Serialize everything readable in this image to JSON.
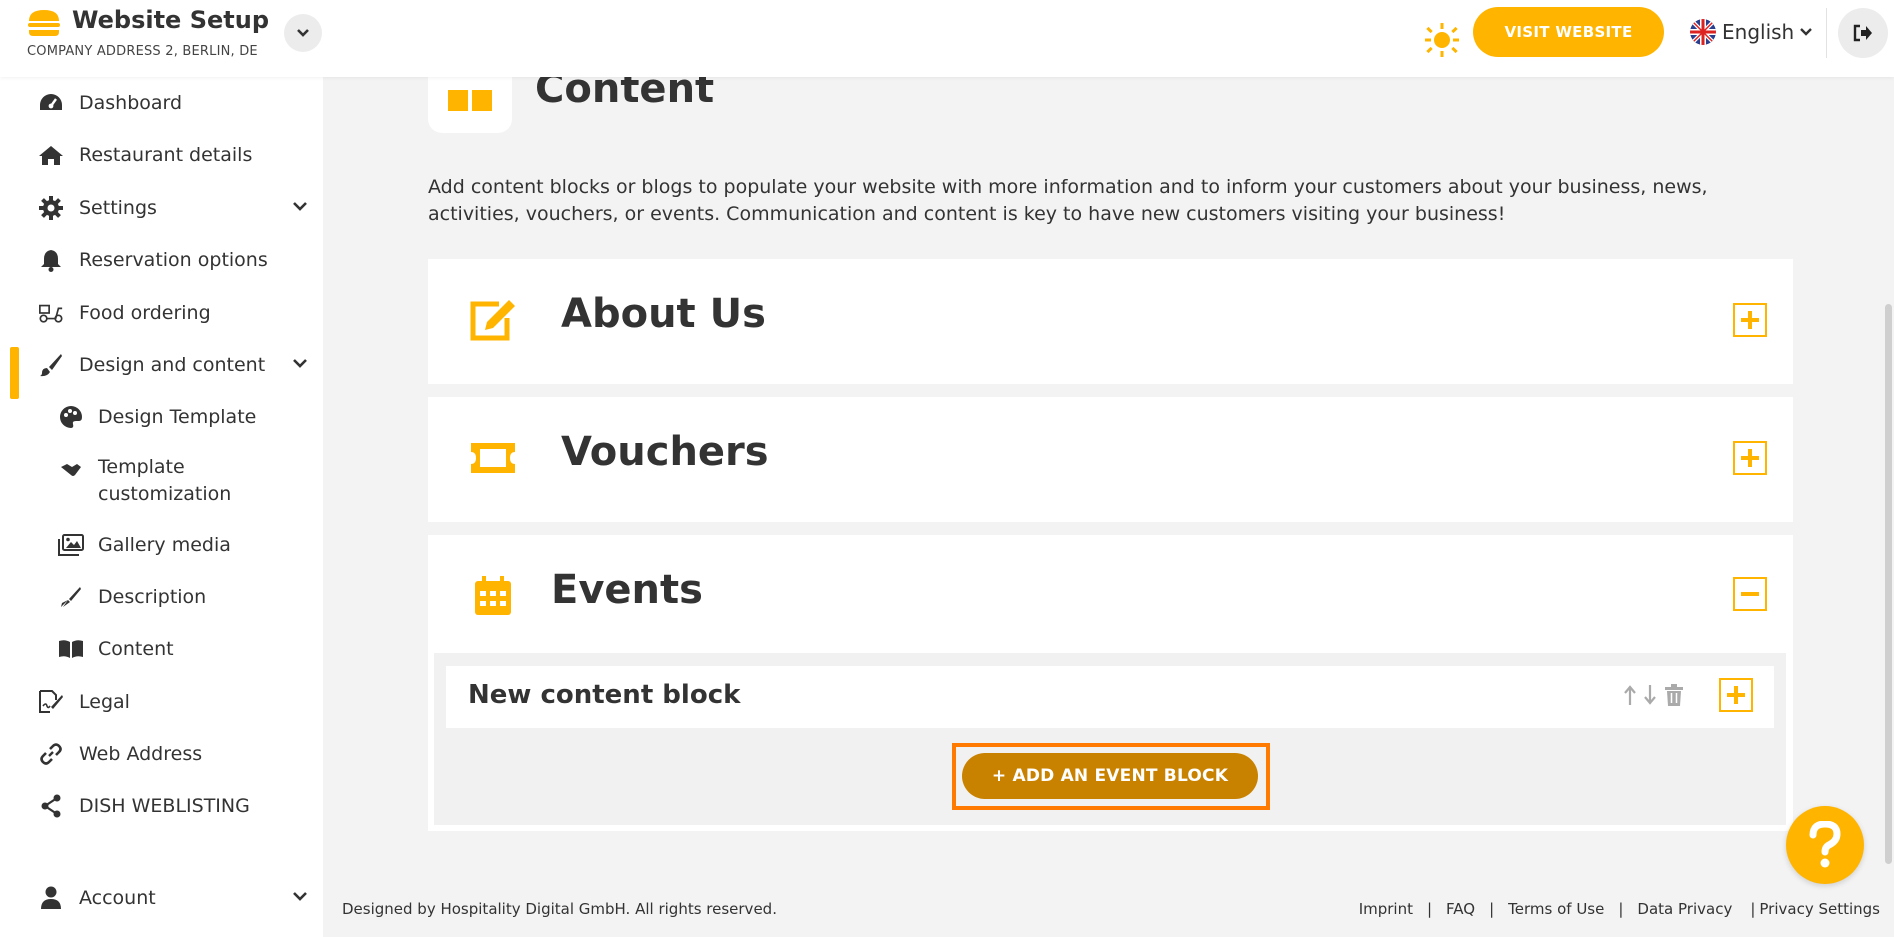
{
  "header": {
    "title": "Website Setup",
    "address": "COMPANY ADDRESS 2, BERLIN, DE",
    "visit_label": "VISIT WEBSITE",
    "language": "English"
  },
  "sidebar": {
    "items": [
      {
        "label": "Dashboard",
        "icon": "dashboard-icon"
      },
      {
        "label": "Restaurant details",
        "icon": "home-icon"
      },
      {
        "label": "Settings",
        "icon": "gear-icon"
      },
      {
        "label": "Reservation options",
        "icon": "bell-icon"
      },
      {
        "label": "Food ordering",
        "icon": "scooter-icon"
      },
      {
        "label": "Design and content",
        "icon": "brush-icon"
      },
      {
        "label": "Design Template",
        "icon": "palette-icon"
      },
      {
        "label": "Template customization",
        "icon": "handshake-icon"
      },
      {
        "label": "Gallery media",
        "icon": "images-icon"
      },
      {
        "label": "Description",
        "icon": "pen-icon"
      },
      {
        "label": "Content",
        "icon": "book-icon"
      },
      {
        "label": "Legal",
        "icon": "signature-icon"
      },
      {
        "label": "Web Address",
        "icon": "link-icon"
      },
      {
        "label": "DISH WEBLISTING",
        "icon": "share-icon"
      },
      {
        "label": "Account",
        "icon": "user-icon"
      }
    ]
  },
  "main": {
    "title": "Content",
    "intro": "Add content blocks or blogs to populate your website with more information and to inform your customers about your business, news, activities, vouchers, or events. Communication and content is key to have new customers visiting your business!",
    "panels": [
      {
        "title": "About Us"
      },
      {
        "title": "Vouchers"
      },
      {
        "title": "Events"
      }
    ],
    "events_block": {
      "title": "New content block",
      "add_label": "+ ADD AN EVENT BLOCK"
    }
  },
  "footer": {
    "copyright": "Designed by Hospitality Digital GmbH. All rights reserved.",
    "links": [
      "Imprint",
      "FAQ",
      "Terms of Use",
      "Data Privacy",
      "Privacy Settings"
    ]
  },
  "colors": {
    "accent": "#ffb400",
    "add_button": "#c98200",
    "highlight": "#ff7a00"
  }
}
